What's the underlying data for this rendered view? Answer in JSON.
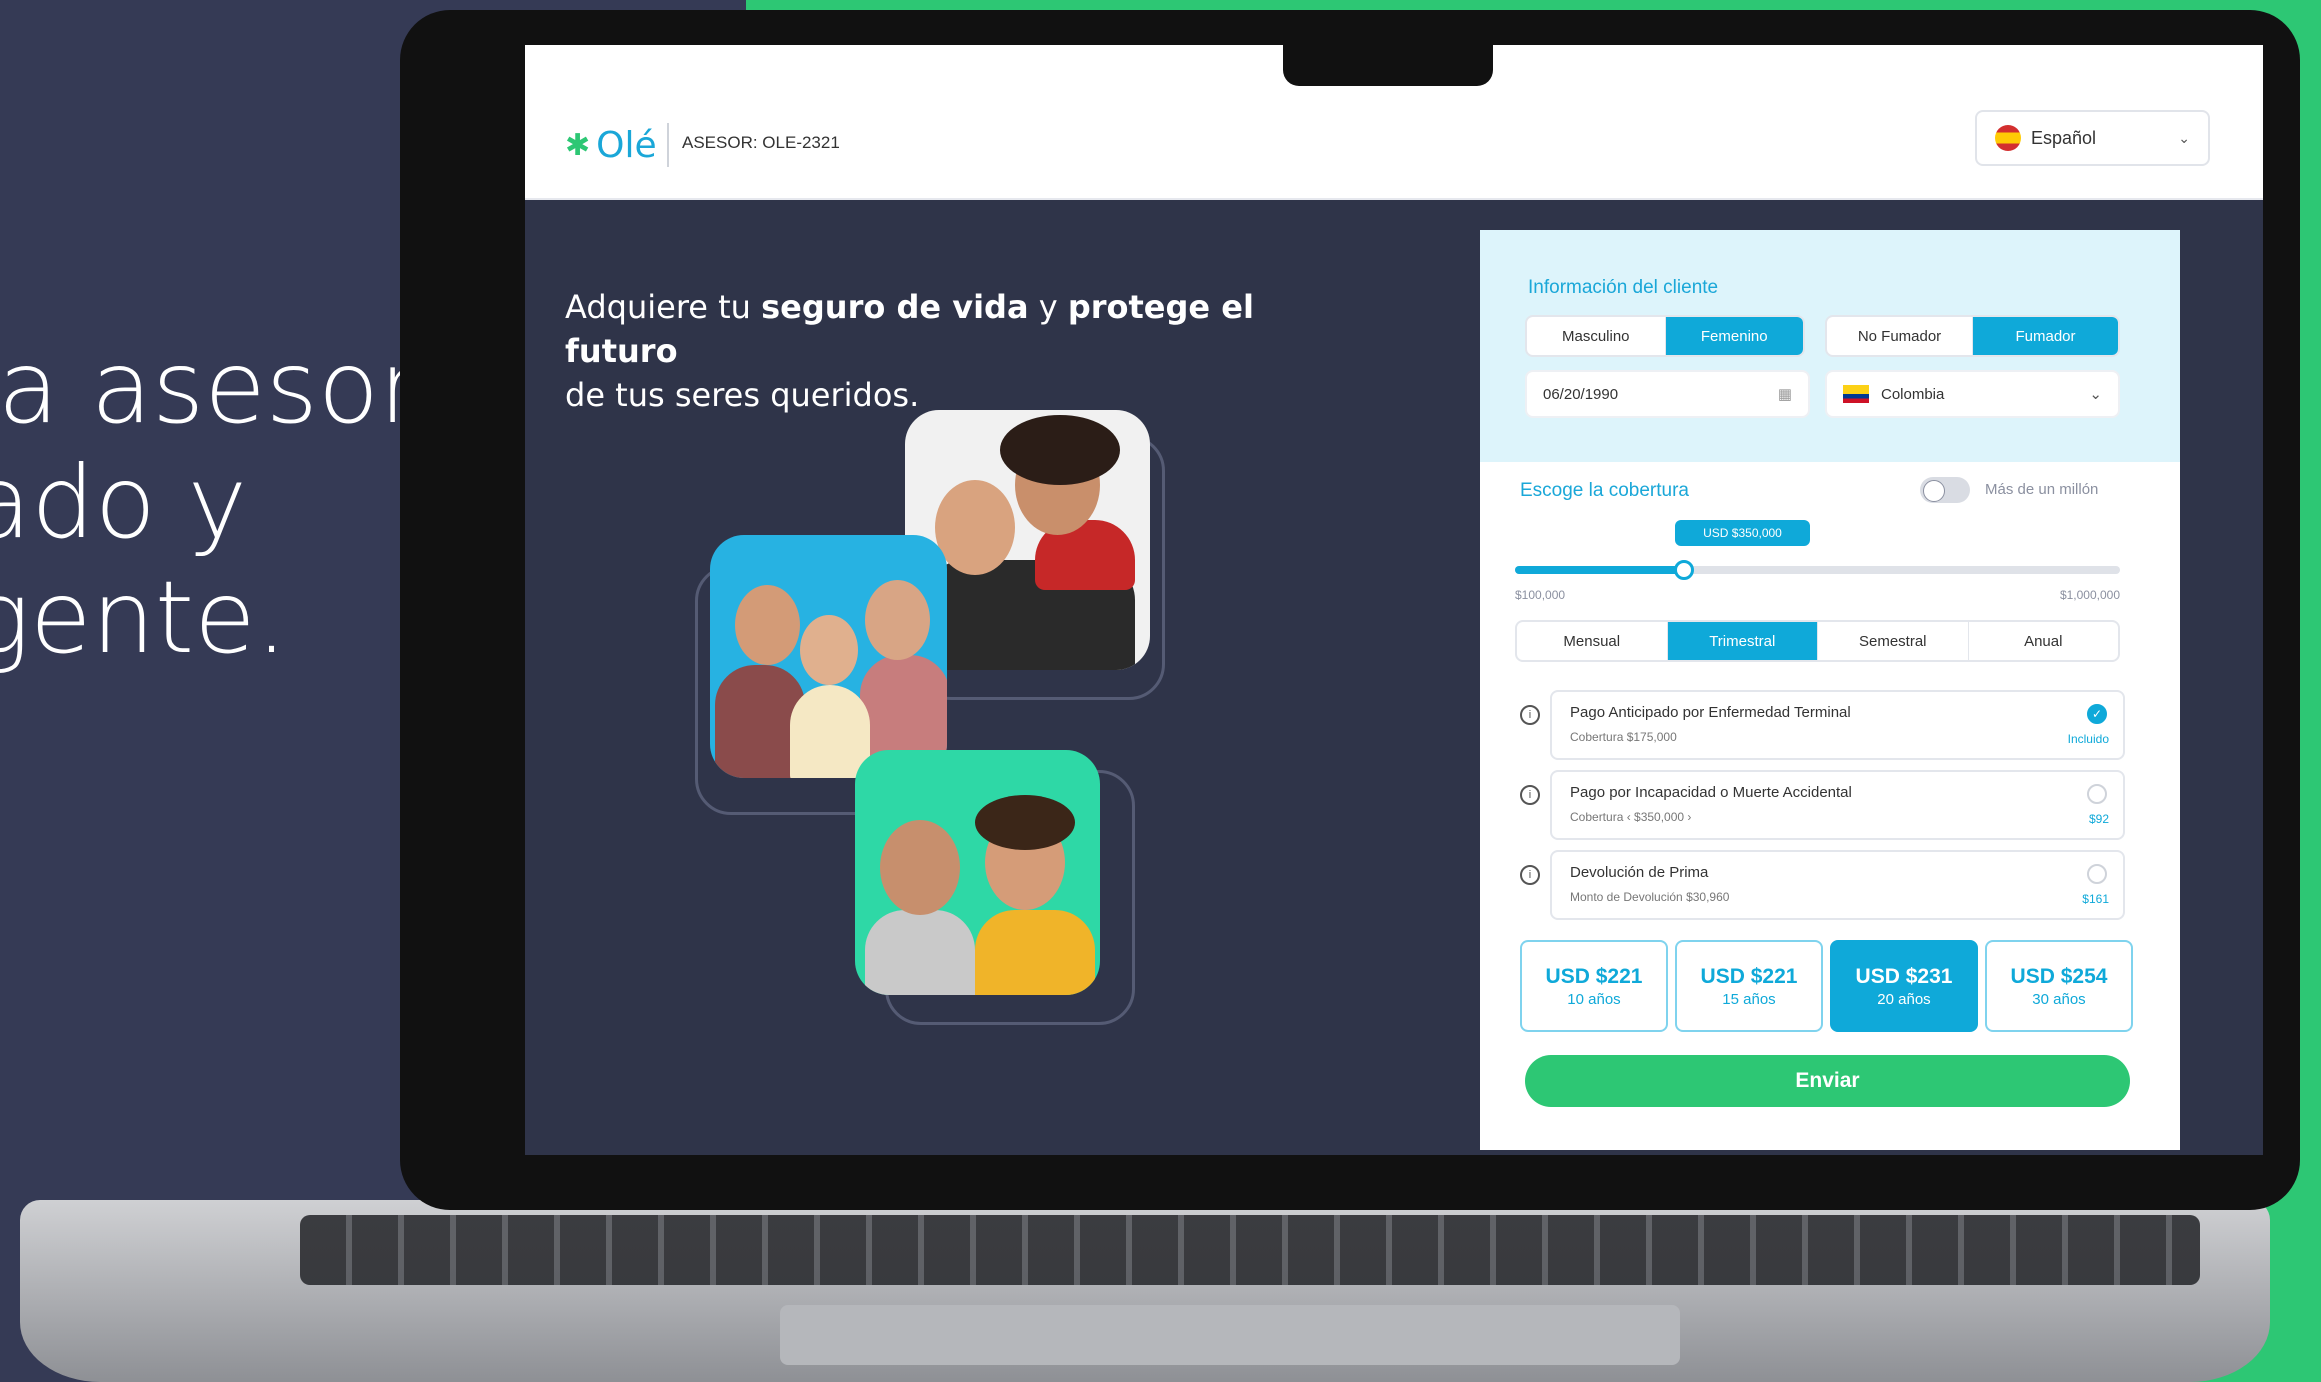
{
  "tagline": {
    "line1": "la asesor",
    "line2": "ado y",
    "line3": "gente."
  },
  "header": {
    "logo": "Olé",
    "asesor": "ASESOR: OLE-2321",
    "language": "Español"
  },
  "hero": {
    "text_1": "Adquiere tu ",
    "bold_1": "seguro de vida",
    "text_2": " y ",
    "bold_2": "protege el futuro",
    "text_3": "de tus seres queridos."
  },
  "client": {
    "title": "Información del cliente",
    "gender": [
      "Masculino",
      "Femenino"
    ],
    "smoker": [
      "No Fumador",
      "Fumador"
    ],
    "birthdate": "06/20/1990",
    "country": "Colombia"
  },
  "coverage": {
    "title": "Escoge la cobertura",
    "toggle_label": "Más de un millón",
    "slider_value": "USD $350,000",
    "slider_fraction": 0.28,
    "min": "$100,000",
    "max": "$1,000,000",
    "frequency": [
      "Mensual",
      "Trimestral",
      "Semestral",
      "Anual"
    ],
    "options": [
      {
        "title": "Pago Anticipado por Enfermedad Terminal",
        "sub": "Cobertura $175,000",
        "price": "Incluido",
        "checked": true
      },
      {
        "title": "Pago por Incapacidad o Muerte Accidental",
        "sub": "Cobertura ‹ $350,000 ›",
        "price": "$92",
        "checked": false
      },
      {
        "title": "Devolución de Prima",
        "sub": "Monto de Devolución $30,960",
        "price": "$161",
        "checked": false
      }
    ]
  },
  "plans": [
    {
      "price": "USD $221",
      "years": "10 años"
    },
    {
      "price": "USD $221",
      "years": "15 años"
    },
    {
      "price": "USD $231",
      "years": "20 años"
    },
    {
      "price": "USD $254",
      "years": "30 años"
    }
  ],
  "submit": "Enviar",
  "colors": {
    "accent": "#0fa9d9",
    "green": "#2dc774",
    "dark": "#2f3449"
  }
}
